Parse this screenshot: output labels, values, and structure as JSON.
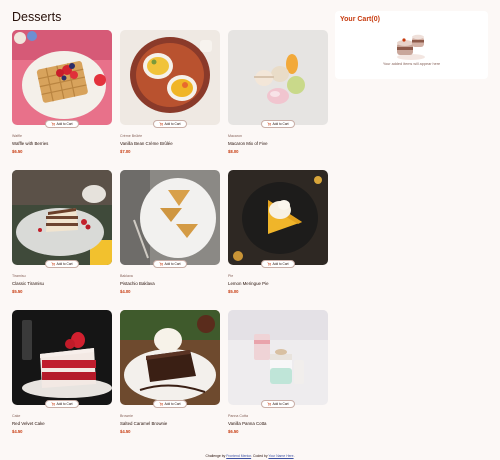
{
  "page": {
    "title": "Desserts"
  },
  "products": [
    {
      "category": "Waffle",
      "name": "Waffle with Berries",
      "price": "$6.50",
      "add_label": "Add to Cart"
    },
    {
      "category": "Crème Brûlée",
      "name": "Vanilla Bean Crème Brûlée",
      "price": "$7.00",
      "add_label": "Add to Cart"
    },
    {
      "category": "Macaron",
      "name": "Macaron Mix of Five",
      "price": "$8.00",
      "add_label": "Add to Cart"
    },
    {
      "category": "Tiramisu",
      "name": "Classic Tiramisu",
      "price": "$5.50",
      "add_label": "Add to Cart"
    },
    {
      "category": "Baklava",
      "name": "Pistachio Baklava",
      "price": "$4.00",
      "add_label": "Add to Cart"
    },
    {
      "category": "Pie",
      "name": "Lemon Meringue Pie",
      "price": "$5.00",
      "add_label": "Add to Cart"
    },
    {
      "category": "Cake",
      "name": "Red Velvet Cake",
      "price": "$4.50",
      "add_label": "Add to Cart"
    },
    {
      "category": "Brownie",
      "name": "Salted Caramel Brownie",
      "price": "$4.50",
      "add_label": "Add to Cart"
    },
    {
      "category": "Panna Cotta",
      "name": "Vanilla Panna Cotta",
      "price": "$6.50",
      "add_label": "Add to Cart"
    }
  ],
  "cart": {
    "title": "Your Cart(0)",
    "empty_message": "Your added items will appear here"
  },
  "footer": {
    "prefix": "Challenge by",
    "challenge_link": "Frontend Mentor",
    "middle": ". Coded by",
    "author_link": "Your Name Here",
    "suffix": "."
  },
  "colors": {
    "accent": "#c73b0f",
    "background": "#fcf8f6",
    "text": "#260f08",
    "muted": "#87635a"
  },
  "icons": {
    "add_to_cart": "add-to-cart-icon",
    "empty_cart": "empty-cart-illustration"
  }
}
